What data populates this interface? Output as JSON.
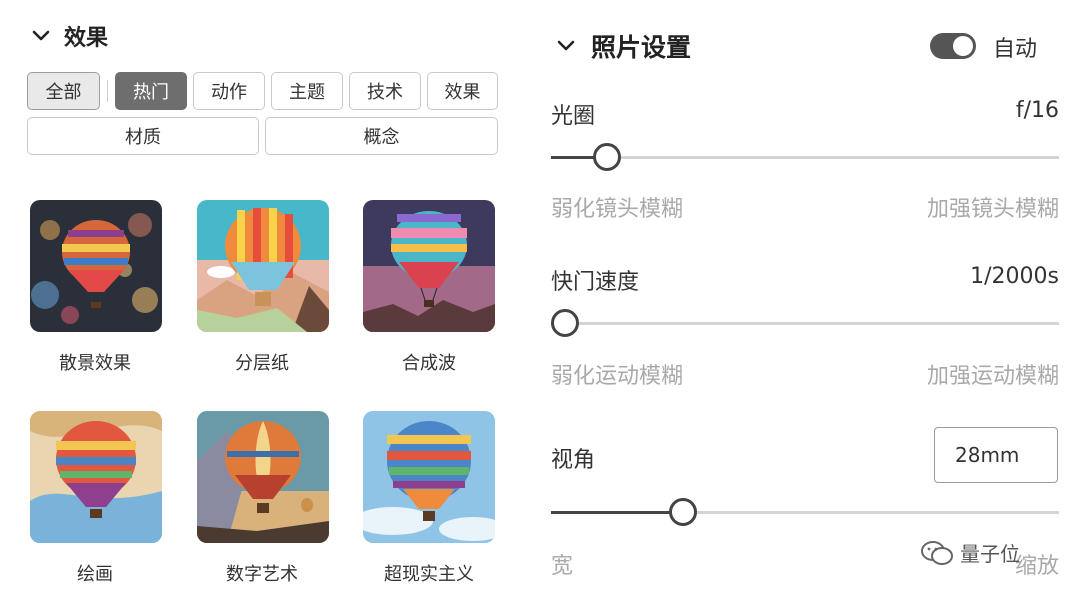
{
  "left": {
    "section_title": "效果",
    "filters_row1": [
      "全部",
      "热门",
      "动作",
      "主题",
      "技术",
      "效果"
    ],
    "filters_row2": [
      "材质",
      "概念"
    ],
    "thumbnails": [
      {
        "label": "散景效果"
      },
      {
        "label": "分层纸"
      },
      {
        "label": "合成波"
      },
      {
        "label": "绘画"
      },
      {
        "label": "数字艺术"
      },
      {
        "label": "超现实主义"
      }
    ]
  },
  "right": {
    "title": "照片设置",
    "auto_toggle": {
      "label": "自动",
      "on": true
    },
    "aperture": {
      "label": "光圈",
      "value": "f/16",
      "level": 0.11,
      "min_hint": "弱化镜头模糊",
      "max_hint": "加强镜头模糊"
    },
    "shutter": {
      "label": "快门速度",
      "value": "1/2000s",
      "level": 0.0,
      "min_hint": "弱化运动模糊",
      "max_hint": "加强运动模糊"
    },
    "fov": {
      "label": "视角",
      "value": "28mm",
      "level": 0.26,
      "min_hint": "宽",
      "max_hint": "缩放"
    }
  },
  "watermark": {
    "text": "量子位"
  },
  "colors": {
    "accent_dark": "#6e6e6e",
    "slider": "#444444",
    "hint": "#a9a9a9"
  }
}
